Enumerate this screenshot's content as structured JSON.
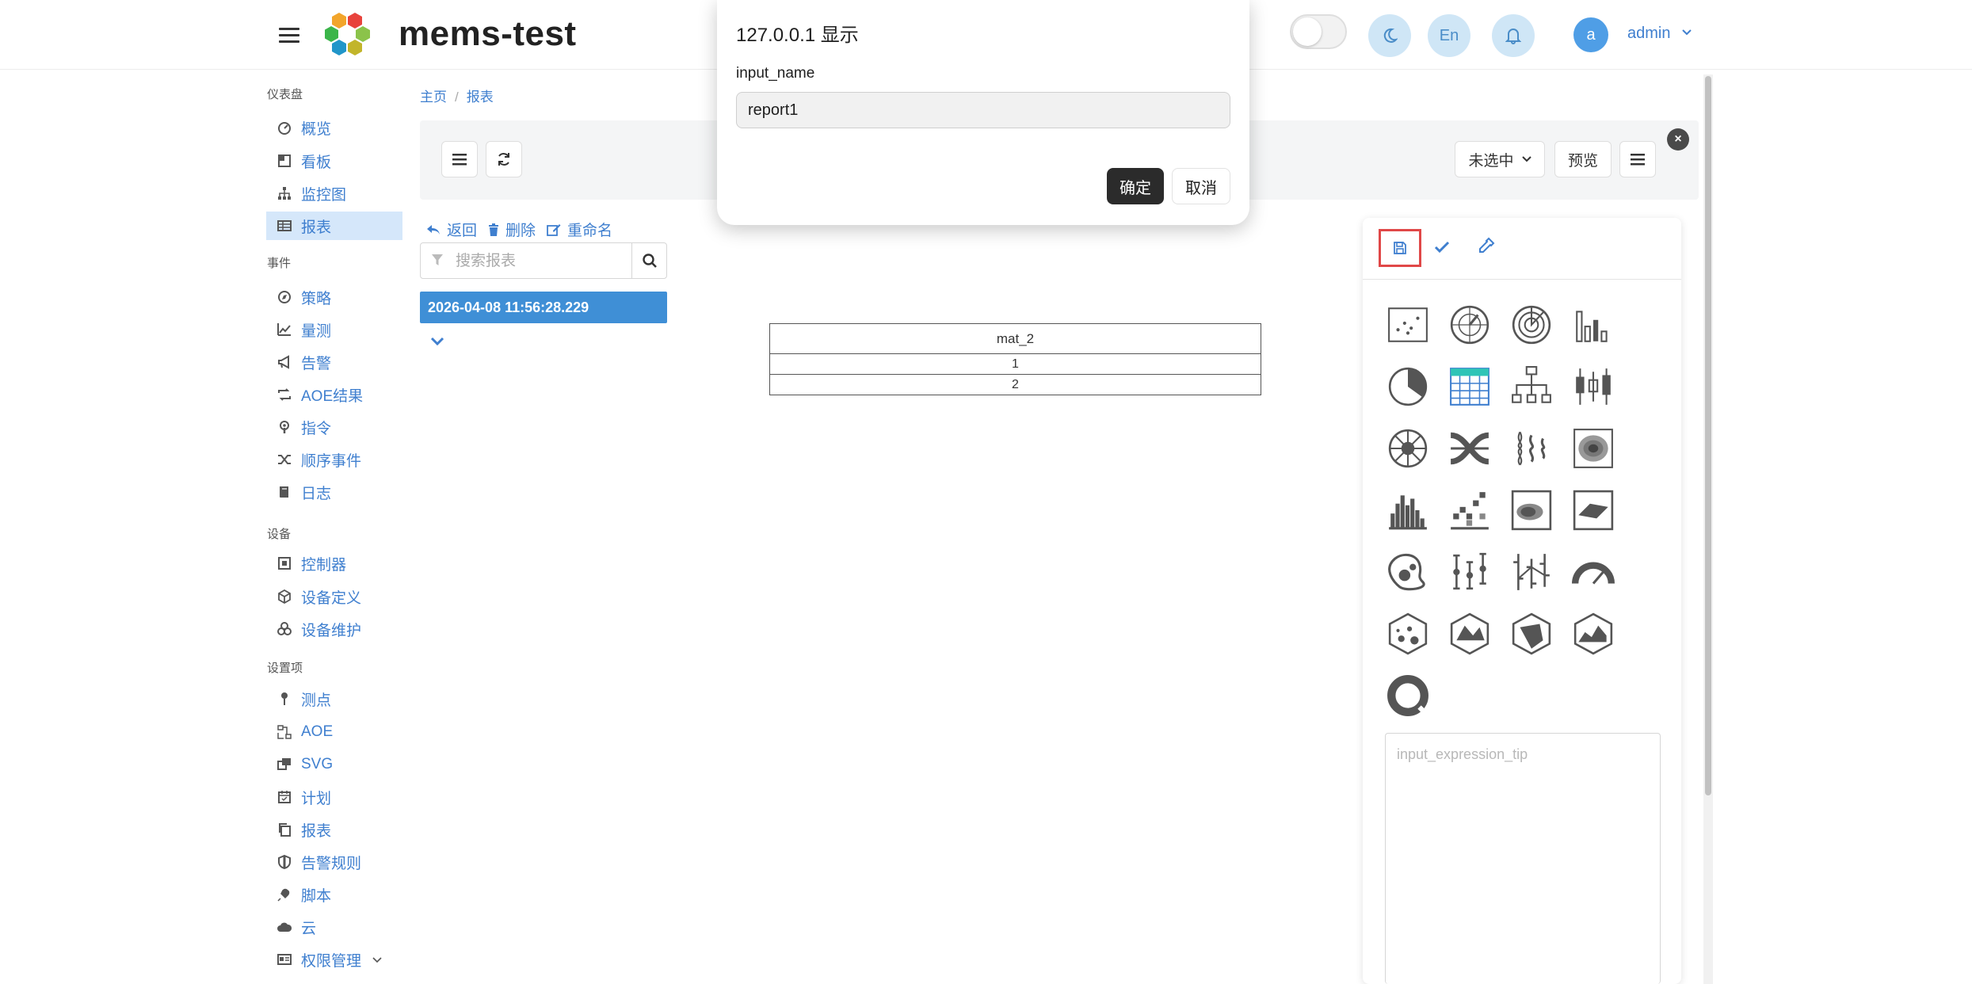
{
  "app": {
    "title": "mems-test"
  },
  "header": {
    "lang_label": "En",
    "user_initial": "a",
    "user_name": "admin"
  },
  "sidebar": {
    "sections": [
      {
        "title": "仪表盘",
        "items": [
          {
            "label": "概览",
            "icon": "dashboard-icon"
          },
          {
            "label": "看板",
            "icon": "board-icon"
          },
          {
            "label": "监控图",
            "icon": "sitemap-icon"
          },
          {
            "label": "报表",
            "icon": "table-icon",
            "active": true
          }
        ]
      },
      {
        "title": "事件",
        "items": [
          {
            "label": "策略",
            "icon": "compass-icon"
          },
          {
            "label": "量测",
            "icon": "line-chart-icon"
          },
          {
            "label": "告警",
            "icon": "bullhorn-icon"
          },
          {
            "label": "AOE结果",
            "icon": "retweet-icon"
          },
          {
            "label": "指令",
            "icon": "podcast-icon"
          },
          {
            "label": "顺序事件",
            "icon": "random-icon"
          },
          {
            "label": "日志",
            "icon": "book-icon"
          }
        ]
      },
      {
        "title": "设备",
        "items": [
          {
            "label": "控制器",
            "icon": "controller-icon"
          },
          {
            "label": "设备定义",
            "icon": "cube-icon"
          },
          {
            "label": "设备维护",
            "icon": "cubes-icon"
          }
        ]
      },
      {
        "title": "设置项",
        "items": [
          {
            "label": "测点",
            "icon": "pin-icon"
          },
          {
            "label": "AOE",
            "icon": "flow-icon"
          },
          {
            "label": "SVG",
            "icon": "window-icon"
          },
          {
            "label": "计划",
            "icon": "calendar-icon"
          },
          {
            "label": "报表",
            "icon": "copy-icon"
          },
          {
            "label": "告警规则",
            "icon": "shield-icon"
          },
          {
            "label": "脚本",
            "icon": "plug-icon"
          },
          {
            "label": "云",
            "icon": "cloud-icon"
          },
          {
            "label": "权限管理",
            "icon": "id-card-icon",
            "has_submenu": true
          }
        ]
      }
    ]
  },
  "breadcrumb": {
    "home": "主页",
    "current": "报表"
  },
  "toolbar": {
    "select_value": "未选中",
    "preview_label": "预览"
  },
  "actions": {
    "back": "返回",
    "delete": "删除",
    "rename": "重命名"
  },
  "search": {
    "placeholder": "搜索报表"
  },
  "report_list": [
    "2026-04-08 11:56:28.229"
  ],
  "report_table": {
    "header": "mat_2",
    "rows": [
      "1",
      "2"
    ]
  },
  "panel": {
    "chart_types": [
      "scatter-chart-icon",
      "polar-chart-icon",
      "radial-chart-icon",
      "bar-chart-icon",
      "pie-chart-icon",
      "table-chart-icon",
      "tree-chart-icon",
      "candlestick-chart-icon",
      "sunburst-chart-icon",
      "sankey-chart-icon",
      "violin-chart-icon",
      "contour-chart-icon",
      "histogram-chart-icon",
      "heatmap-chart-icon",
      "density-chart-icon",
      "surface-chart-icon",
      "choropleth-chart-icon",
      "error-bar-chart-icon",
      "ohlc-chart-icon",
      "gauge-chart-icon",
      "bubble-3d-chart-icon",
      "mesh-3d-chart-icon",
      "volume-3d-chart-icon",
      "terrain-3d-chart-icon",
      "donut-chart-icon"
    ],
    "expression_placeholder": "input_expression_tip"
  },
  "dialog": {
    "title": "127.0.0.1 显示",
    "label": "input_name",
    "value": "report1",
    "ok": "确定",
    "cancel": "取消"
  }
}
